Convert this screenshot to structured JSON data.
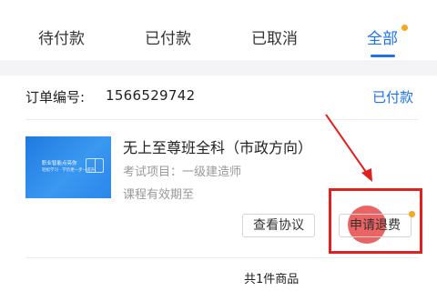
{
  "tabs": [
    {
      "label": "待付款",
      "active": false
    },
    {
      "label": "已付款",
      "active": false
    },
    {
      "label": "已取消",
      "active": false
    },
    {
      "label": "全部",
      "active": true
    }
  ],
  "order": {
    "number_label": "订单编号:",
    "number": "1566529742",
    "status": "已付款"
  },
  "course": {
    "thumbnail_caption": "职业智能点亮你",
    "thumbnail_subcaption": "轻松学习 · 学历更一步一提升",
    "title": "无上至尊班全科（市政方向）",
    "exam_item": "考试项目：一级建造师",
    "validity": "课程有效期至"
  },
  "actions": {
    "view_agreement": "查看协议",
    "request_refund": "申请退费"
  },
  "summary": {
    "total_items": "共1件商品"
  },
  "colors": {
    "accent": "#1a73e8",
    "notification_dot": "#f5a623",
    "annotation": "#e21f1f"
  }
}
